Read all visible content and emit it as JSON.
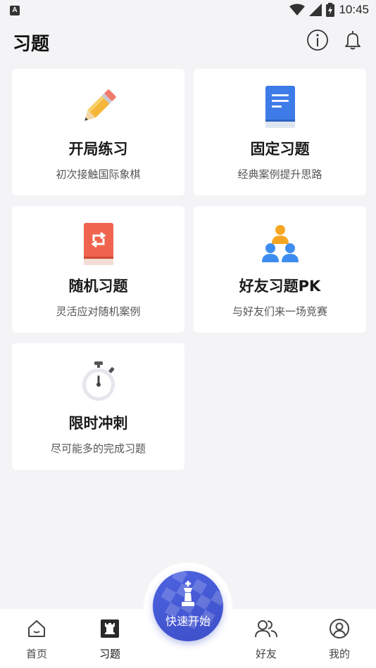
{
  "status_bar": {
    "badge": "A",
    "time": "10:45"
  },
  "header": {
    "title": "习题"
  },
  "cards": [
    {
      "title": "开局练习",
      "subtitle": "初次接触国际象棋",
      "icon": "pencil-icon"
    },
    {
      "title": "固定习题",
      "subtitle": "经典案例提升思路",
      "icon": "blue-book-icon"
    },
    {
      "title": "随机习题",
      "subtitle": "灵活应对随机案例",
      "icon": "shuffle-book-icon"
    },
    {
      "title": "好友习题PK",
      "subtitle": "与好友们来一场竞赛",
      "icon": "friends-group-icon"
    },
    {
      "title": "限时冲刺",
      "subtitle": "尽可能多的完成习题",
      "icon": "stopwatch-icon"
    }
  ],
  "bottom_nav": {
    "tabs": [
      {
        "label": "首页",
        "icon": "home-icon"
      },
      {
        "label": "习题",
        "icon": "exercise-board-icon",
        "active": true
      },
      {
        "label": "好友",
        "icon": "friends-icon"
      },
      {
        "label": "我的",
        "icon": "profile-icon"
      }
    ],
    "quick_start": {
      "label": "快速开始",
      "icon": "chess-king-icon"
    }
  },
  "colors": {
    "accent": "#4456d6",
    "background": "#f4f4f6",
    "card": "#ffffff",
    "book_blue": "#3d7be8",
    "book_red": "#f0644e",
    "person_orange": "#f5a623",
    "person_blue": "#3d8df0"
  }
}
